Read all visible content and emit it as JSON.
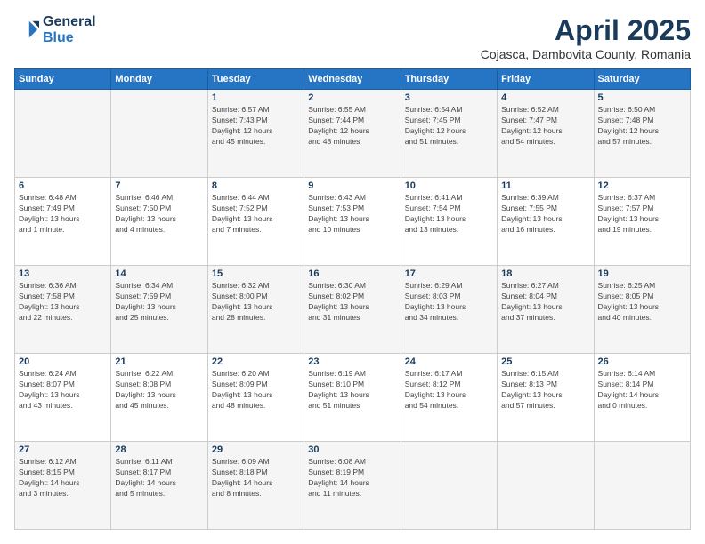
{
  "header": {
    "logo_line1": "General",
    "logo_line2": "Blue",
    "month": "April 2025",
    "location": "Cojasca, Dambovita County, Romania"
  },
  "weekdays": [
    "Sunday",
    "Monday",
    "Tuesday",
    "Wednesday",
    "Thursday",
    "Friday",
    "Saturday"
  ],
  "weeks": [
    [
      {
        "day": "",
        "detail": ""
      },
      {
        "day": "",
        "detail": ""
      },
      {
        "day": "1",
        "detail": "Sunrise: 6:57 AM\nSunset: 7:43 PM\nDaylight: 12 hours\nand 45 minutes."
      },
      {
        "day": "2",
        "detail": "Sunrise: 6:55 AM\nSunset: 7:44 PM\nDaylight: 12 hours\nand 48 minutes."
      },
      {
        "day": "3",
        "detail": "Sunrise: 6:54 AM\nSunset: 7:45 PM\nDaylight: 12 hours\nand 51 minutes."
      },
      {
        "day": "4",
        "detail": "Sunrise: 6:52 AM\nSunset: 7:47 PM\nDaylight: 12 hours\nand 54 minutes."
      },
      {
        "day": "5",
        "detail": "Sunrise: 6:50 AM\nSunset: 7:48 PM\nDaylight: 12 hours\nand 57 minutes."
      }
    ],
    [
      {
        "day": "6",
        "detail": "Sunrise: 6:48 AM\nSunset: 7:49 PM\nDaylight: 13 hours\nand 1 minute."
      },
      {
        "day": "7",
        "detail": "Sunrise: 6:46 AM\nSunset: 7:50 PM\nDaylight: 13 hours\nand 4 minutes."
      },
      {
        "day": "8",
        "detail": "Sunrise: 6:44 AM\nSunset: 7:52 PM\nDaylight: 13 hours\nand 7 minutes."
      },
      {
        "day": "9",
        "detail": "Sunrise: 6:43 AM\nSunset: 7:53 PM\nDaylight: 13 hours\nand 10 minutes."
      },
      {
        "day": "10",
        "detail": "Sunrise: 6:41 AM\nSunset: 7:54 PM\nDaylight: 13 hours\nand 13 minutes."
      },
      {
        "day": "11",
        "detail": "Sunrise: 6:39 AM\nSunset: 7:55 PM\nDaylight: 13 hours\nand 16 minutes."
      },
      {
        "day": "12",
        "detail": "Sunrise: 6:37 AM\nSunset: 7:57 PM\nDaylight: 13 hours\nand 19 minutes."
      }
    ],
    [
      {
        "day": "13",
        "detail": "Sunrise: 6:36 AM\nSunset: 7:58 PM\nDaylight: 13 hours\nand 22 minutes."
      },
      {
        "day": "14",
        "detail": "Sunrise: 6:34 AM\nSunset: 7:59 PM\nDaylight: 13 hours\nand 25 minutes."
      },
      {
        "day": "15",
        "detail": "Sunrise: 6:32 AM\nSunset: 8:00 PM\nDaylight: 13 hours\nand 28 minutes."
      },
      {
        "day": "16",
        "detail": "Sunrise: 6:30 AM\nSunset: 8:02 PM\nDaylight: 13 hours\nand 31 minutes."
      },
      {
        "day": "17",
        "detail": "Sunrise: 6:29 AM\nSunset: 8:03 PM\nDaylight: 13 hours\nand 34 minutes."
      },
      {
        "day": "18",
        "detail": "Sunrise: 6:27 AM\nSunset: 8:04 PM\nDaylight: 13 hours\nand 37 minutes."
      },
      {
        "day": "19",
        "detail": "Sunrise: 6:25 AM\nSunset: 8:05 PM\nDaylight: 13 hours\nand 40 minutes."
      }
    ],
    [
      {
        "day": "20",
        "detail": "Sunrise: 6:24 AM\nSunset: 8:07 PM\nDaylight: 13 hours\nand 43 minutes."
      },
      {
        "day": "21",
        "detail": "Sunrise: 6:22 AM\nSunset: 8:08 PM\nDaylight: 13 hours\nand 45 minutes."
      },
      {
        "day": "22",
        "detail": "Sunrise: 6:20 AM\nSunset: 8:09 PM\nDaylight: 13 hours\nand 48 minutes."
      },
      {
        "day": "23",
        "detail": "Sunrise: 6:19 AM\nSunset: 8:10 PM\nDaylight: 13 hours\nand 51 minutes."
      },
      {
        "day": "24",
        "detail": "Sunrise: 6:17 AM\nSunset: 8:12 PM\nDaylight: 13 hours\nand 54 minutes."
      },
      {
        "day": "25",
        "detail": "Sunrise: 6:15 AM\nSunset: 8:13 PM\nDaylight: 13 hours\nand 57 minutes."
      },
      {
        "day": "26",
        "detail": "Sunrise: 6:14 AM\nSunset: 8:14 PM\nDaylight: 14 hours\nand 0 minutes."
      }
    ],
    [
      {
        "day": "27",
        "detail": "Sunrise: 6:12 AM\nSunset: 8:15 PM\nDaylight: 14 hours\nand 3 minutes."
      },
      {
        "day": "28",
        "detail": "Sunrise: 6:11 AM\nSunset: 8:17 PM\nDaylight: 14 hours\nand 5 minutes."
      },
      {
        "day": "29",
        "detail": "Sunrise: 6:09 AM\nSunset: 8:18 PM\nDaylight: 14 hours\nand 8 minutes."
      },
      {
        "day": "30",
        "detail": "Sunrise: 6:08 AM\nSunset: 8:19 PM\nDaylight: 14 hours\nand 11 minutes."
      },
      {
        "day": "",
        "detail": ""
      },
      {
        "day": "",
        "detail": ""
      },
      {
        "day": "",
        "detail": ""
      }
    ]
  ]
}
